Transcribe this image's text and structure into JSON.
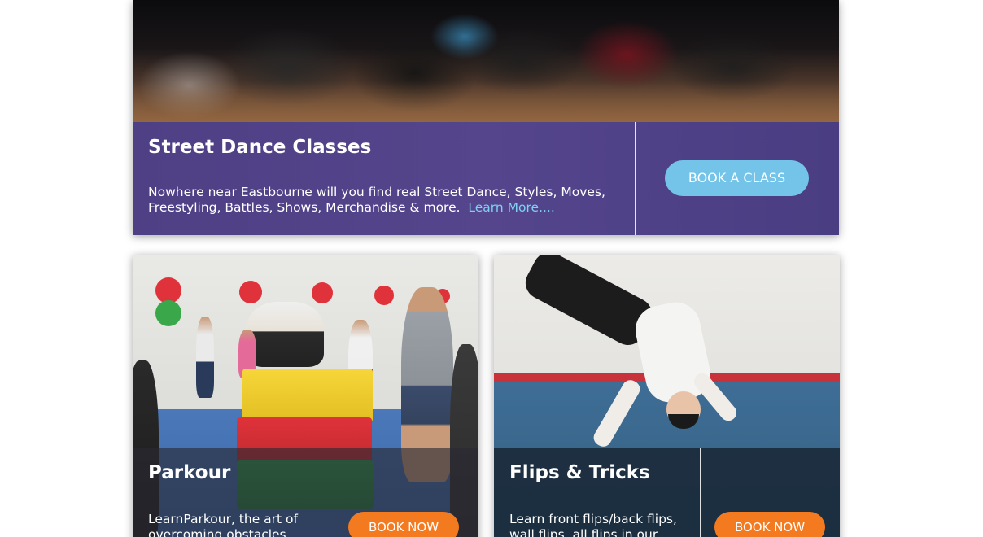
{
  "hero": {
    "title": "Street Dance Classes",
    "description": "Nowhere near Eastbourne will you find real Street Dance, Styles, Moves, Freestyling, Battles, Shows, Merchandise & more.",
    "learn_more": "Learn More....",
    "button": "BOOK A CLASS",
    "image_icon": "street-dance-photo"
  },
  "cards": [
    {
      "title": "Parkour",
      "description": "LearnParkour, the art of overcoming obstacles",
      "button": "BOOK NOW",
      "image_icon": "parkour-photo"
    },
    {
      "title": "Flips & Tricks",
      "description": "Learn front flips/back flips, wall flips, all flips in our",
      "button": "BOOK NOW",
      "image_icon": "flips-photo"
    }
  ],
  "colors": {
    "hero_band": "#51428a",
    "hero_button": "#73c4e8",
    "learn_more_link": "#7fd0f0",
    "card_button": "#f47a1f"
  }
}
